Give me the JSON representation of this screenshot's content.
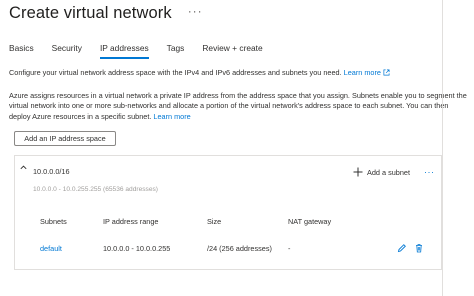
{
  "header": {
    "title": "Create virtual network",
    "more_label": "···"
  },
  "tabs": [
    {
      "label": "Basics",
      "active": false
    },
    {
      "label": "Security",
      "active": false
    },
    {
      "label": "IP addresses",
      "active": true
    },
    {
      "label": "Tags",
      "active": false
    },
    {
      "label": "Review + create",
      "active": false
    }
  ],
  "intro": {
    "text": "Configure your virtual network address space with the IPv4 and IPv6 addresses and subnets you need.",
    "learn_more": "Learn more"
  },
  "info": {
    "text": "Azure assigns resources in a virtual network a private IP address from the address space that you assign. Subnets enable you to segment the virtual network into one or more sub-networks and allocate a portion of the virtual network's address space to each subnet. You can then deploy Azure resources in a specific subnet.",
    "learn_more": "Learn more"
  },
  "add_space_button": "Add an IP address space",
  "address_space": {
    "address": "10.0.0.0/16",
    "range": "10.0.0.0 - 10.0.255.255 (65536 addresses)",
    "add_subnet_label": "Add a subnet",
    "more_label": "···",
    "columns": {
      "subnets": "Subnets",
      "ip_range": "IP address range",
      "size": "Size",
      "nat": "NAT gateway"
    },
    "rows": [
      {
        "name": "default",
        "ip_range": "10.0.0.0 - 10.0.0.255",
        "size": "/24 (256 addresses)",
        "nat": "-"
      }
    ]
  },
  "colors": {
    "accent": "#0078d4",
    "delete": "#0078d4",
    "border": "#e1dfdd",
    "muted_text": "#a19f9d"
  }
}
